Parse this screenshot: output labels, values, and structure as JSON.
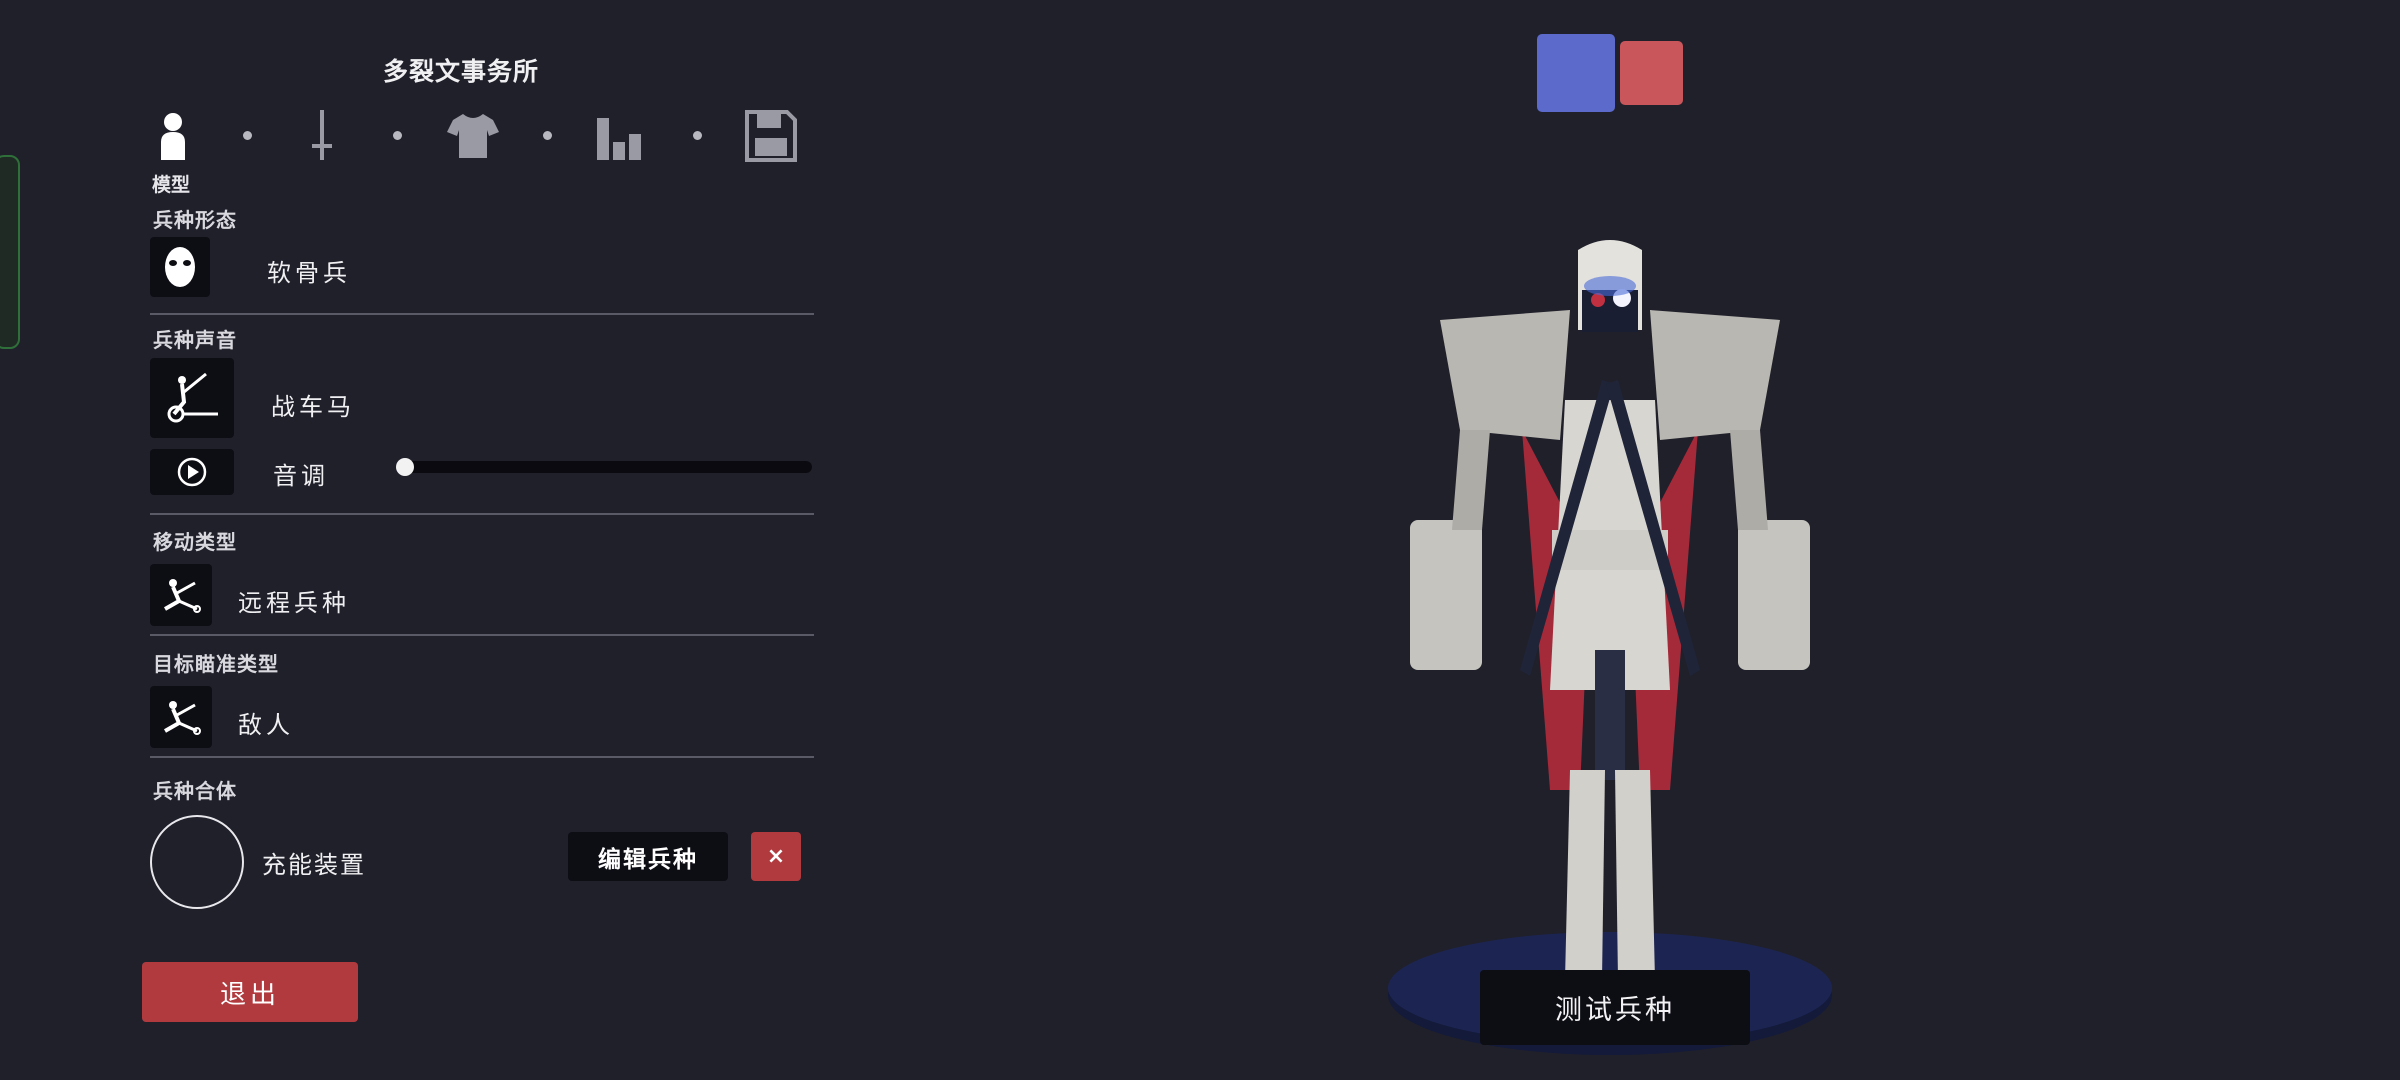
{
  "title": "多裂文事务所",
  "steps": {
    "active_label": "模型",
    "icons": [
      "person-icon",
      "sword-icon",
      "shirt-icon",
      "bar-chart-icon",
      "save-icon"
    ]
  },
  "sections": {
    "form": {
      "label": "兵种形态",
      "value": "软骨兵",
      "icon": "mask-icon"
    },
    "voice": {
      "label": "兵种声音",
      "value": "战车马",
      "icon": "chariot-icon",
      "pitch_label": "音调",
      "pitch_level": 0.0
    },
    "movement": {
      "label": "移动类型",
      "value": "远程兵种",
      "icon": "unit-pose-icon"
    },
    "targeting": {
      "label": "目标瞄准类型",
      "value": "敌人",
      "icon": "unit-pose-icon"
    },
    "combine": {
      "label": "兵种合体",
      "value": "充能装置",
      "edit_label": "编辑兵种",
      "close_label": "×"
    }
  },
  "exit_label": "退出",
  "team_colors": {
    "blue": "#5b6acb",
    "red": "#c9565a"
  },
  "test_label": "测试兵种"
}
